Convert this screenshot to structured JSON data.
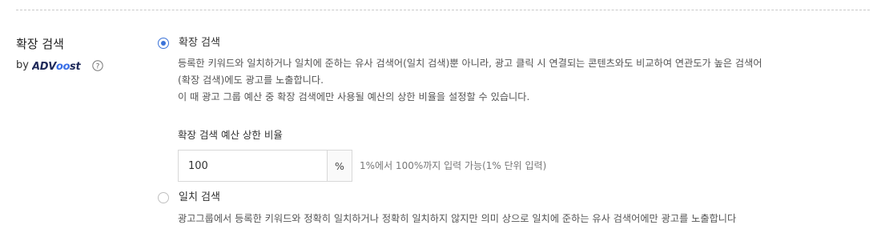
{
  "section": {
    "title": "확장 검색",
    "by_prefix": "by",
    "brand_name": "ADVoost"
  },
  "options": [
    {
      "label": "확장 검색",
      "checked": true,
      "description": [
        "등록한 키워드와 일치하거나 일치에 준하는 유사 검색어(일치 검색)뿐 아니라, 광고 클릭 시 연결되는 콘텐츠와도 비교하여 연관도가 높은 검색어",
        "(확장 검색)에도 광고를 노출합니다.",
        "이 때 광고 그룹 예산 중 확장 검색에만 사용될 예산의 상한 비율을 설정할 수 있습니다."
      ]
    },
    {
      "label": "일치 검색",
      "checked": false,
      "description": [
        "광고그룹에서 등록한 키워드와 정확히 일치하거나 정확히 일치하지 않지만 의미 상으로 일치에 준하는 유사 검색어에만 광고를 노출합니다"
      ]
    }
  ],
  "budget_ratio": {
    "label": "확장 검색 예산 상한 비율",
    "value": "100",
    "unit": "%",
    "hint": "1%에서 100%까지 입력 가능(1% 단위 입력)"
  },
  "colors": {
    "accent": "#3b73d8",
    "brand_dark": "#1f2a5a",
    "brand_light": "#3a6fe8"
  },
  "icons": {
    "help": "question-circle-icon",
    "radio_checked": "radio-checked-icon",
    "radio_unchecked": "radio-unchecked-icon"
  }
}
